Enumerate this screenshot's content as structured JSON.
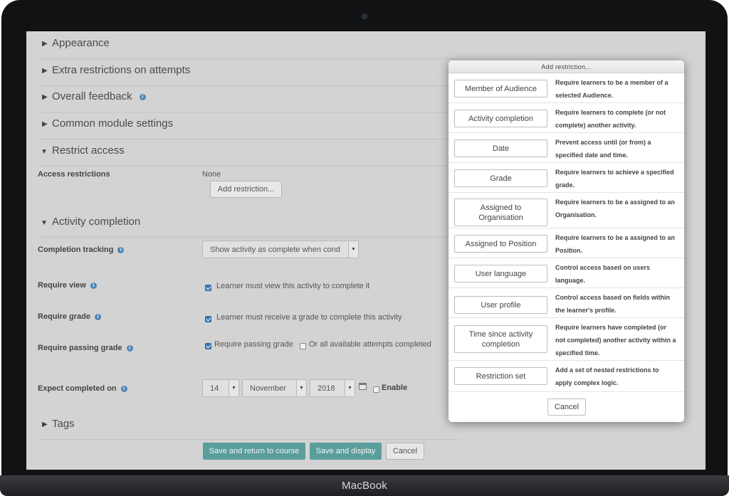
{
  "device": {
    "label": "MacBook"
  },
  "sections": {
    "appearance": "Appearance",
    "extra_restrictions": "Extra restrictions on attempts",
    "overall_feedback": "Overall feedback",
    "common_module": "Common module settings",
    "restrict_access": "Restrict access",
    "activity_completion": "Activity completion",
    "tags": "Tags"
  },
  "restrict": {
    "label": "Access restrictions",
    "value": "None",
    "add_button": "Add restriction..."
  },
  "completion": {
    "tracking_label": "Completion tracking",
    "tracking_value": "Show activity as complete when cond",
    "require_view_label": "Require view",
    "require_view_text": "Learner must view this activity to complete it",
    "require_grade_label": "Require grade",
    "require_grade_text": "Learner must receive a grade to complete this activity",
    "require_passing_label": "Require passing grade",
    "require_passing_text": "Require passing grade",
    "all_attempts_text": "Or all available attempts completed",
    "expect_label": "Expect completed on",
    "day": "14",
    "month": "November",
    "year": "2018",
    "enable_text": "Enable"
  },
  "footer": {
    "save_return": "Save and return to course",
    "save_display": "Save and display",
    "cancel": "Cancel"
  },
  "dialog": {
    "title": "Add restriction...",
    "options": [
      {
        "button": "Member of Audience",
        "desc": "Require learners to be a member of a selected Audience."
      },
      {
        "button": "Activity completion",
        "desc": "Require learners to complete (or not complete) another activity."
      },
      {
        "button": "Date",
        "desc": "Prevent access until (or from) a specified date and time."
      },
      {
        "button": "Grade",
        "desc": "Require learners to achieve a specified grade."
      },
      {
        "button": "Assigned to Organisation",
        "desc": "Require learners to be a assigned to an Organisation."
      },
      {
        "button": "Assigned to Position",
        "desc": "Require learners to be a assigned to an Position."
      },
      {
        "button": "User language",
        "desc": "Control access based on users language."
      },
      {
        "button": "User profile",
        "desc": "Control access based on fields within the learner's profile."
      },
      {
        "button": "Time since activity completion",
        "desc": "Require learners have completed (or not completed) another activity within a specified time."
      },
      {
        "button": "Restriction set",
        "desc": "Add a set of nested restrictions to apply complex logic."
      }
    ],
    "cancel": "Cancel"
  },
  "colors": {
    "primary_button": "#5a9e9c",
    "info_icon": "#4f86b8",
    "checkbox": "#3d7ab5",
    "screen_bg": "#d3d3d3"
  }
}
